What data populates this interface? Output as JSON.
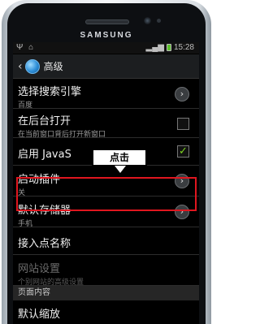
{
  "device": {
    "brand": "SAMSUNG"
  },
  "statusbar": {
    "left_icons": "Ψ ⌂",
    "time": "15:28"
  },
  "titlebar": {
    "title": "高级"
  },
  "rows": [
    {
      "main": "选择搜索引擎",
      "sub": "百度",
      "control": "chevron"
    },
    {
      "main": "在后台打开",
      "sub": "在当前窗口背后打开新窗口",
      "control": "checkbox-off"
    },
    {
      "main": "启用 JavaS",
      "sub": "",
      "control": "checkbox-on"
    },
    {
      "main": "启动插件",
      "sub": "关",
      "control": "chevron"
    },
    {
      "main": "默认存储器",
      "sub": "手机",
      "control": "chevron"
    },
    {
      "main": "接入点名称",
      "sub": "",
      "control": "none"
    },
    {
      "main": "网站设置",
      "sub": "个别网站的高级设置",
      "control": "none",
      "disabled": true
    }
  ],
  "section_header": "页面内容",
  "last_row": {
    "main": "默认缩放"
  },
  "callout": {
    "text": "点击"
  },
  "colors": {
    "highlight": "#e0161f",
    "check": "#7ed321",
    "battery": "#5bbf2a"
  }
}
